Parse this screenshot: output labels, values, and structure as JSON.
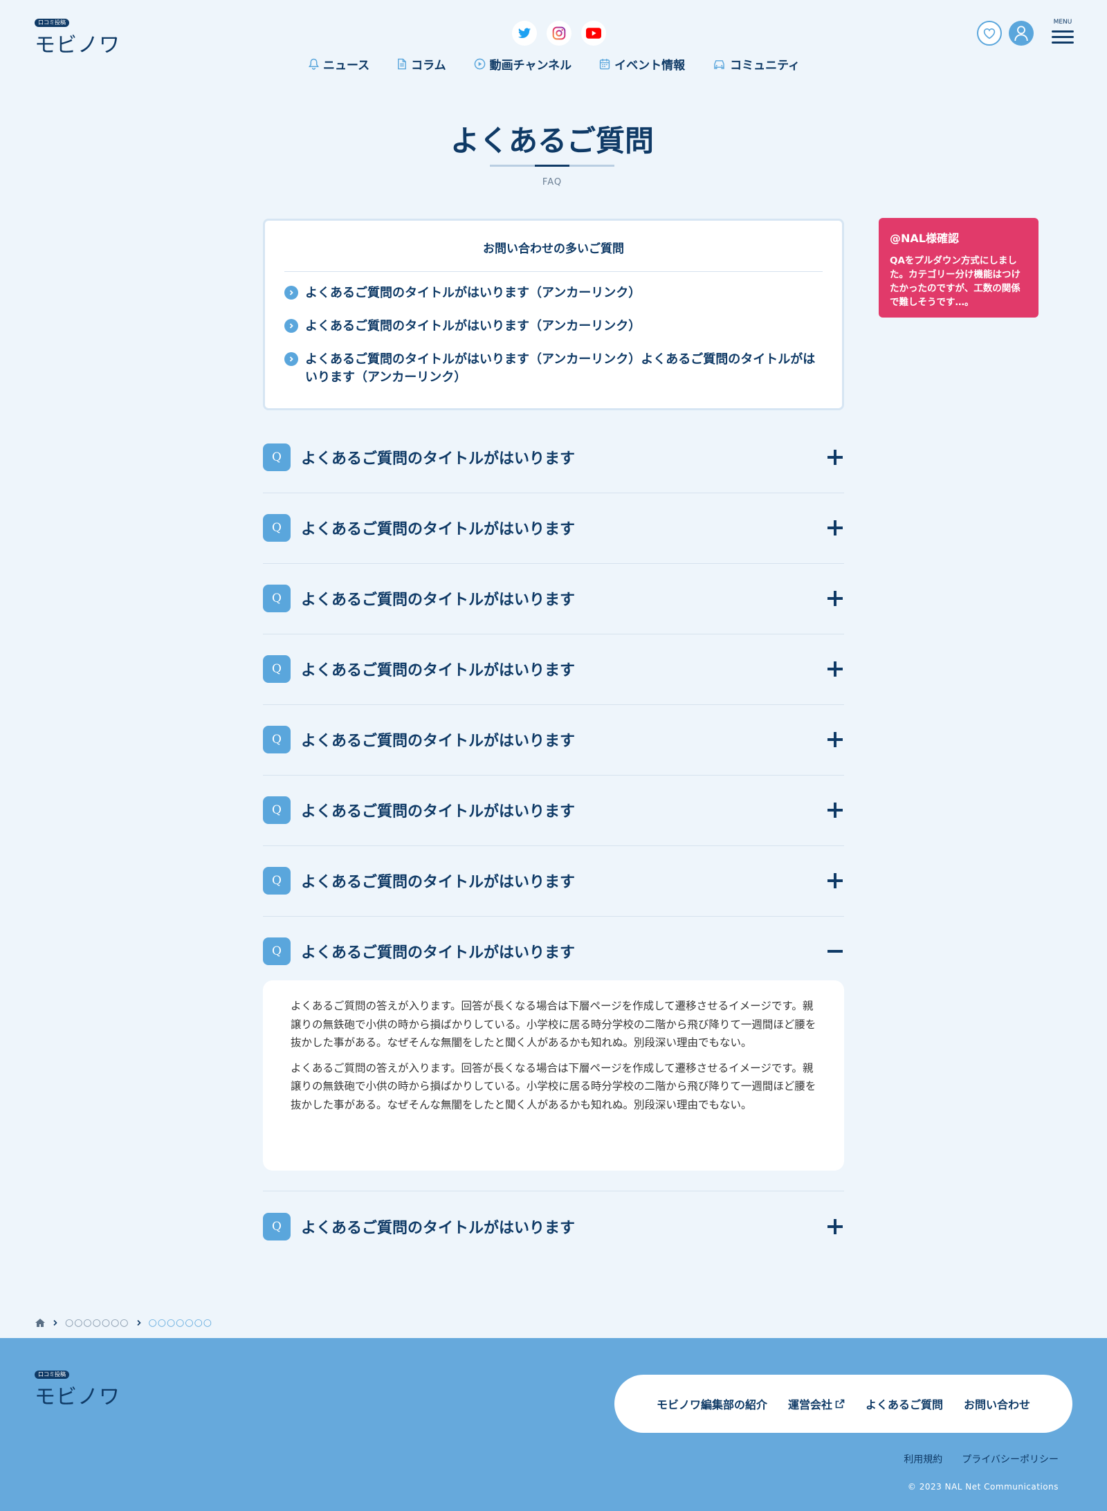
{
  "brand": {
    "badge": "口コミ投稿",
    "name": "モビノワ"
  },
  "header": {
    "social": [
      {
        "icon": "twitter-icon"
      },
      {
        "icon": "instagram-icon"
      },
      {
        "icon": "youtube-icon"
      }
    ],
    "menu_label": "MENU",
    "nav": [
      {
        "label": "ニュース",
        "icon": "bell-icon"
      },
      {
        "label": "コラム",
        "icon": "document-icon"
      },
      {
        "label": "動画チャンネル",
        "icon": "play-icon"
      },
      {
        "label": "イベント情報",
        "icon": "calendar-icon"
      },
      {
        "label": "コミュニティ",
        "icon": "car-icon"
      }
    ]
  },
  "page": {
    "title": "よくあるご質問",
    "subtitle": "FAQ"
  },
  "popular": {
    "title": "お問い合わせの多いご質問",
    "items": [
      "よくあるご質問のタイトルがはいります（アンカーリンク）",
      "よくあるご質問のタイトルがはいります（アンカーリンク）",
      "よくあるご質問のタイトルがはいります（アンカーリンク）よくあるご質問のタイトルがはいります（アンカーリンク）"
    ]
  },
  "note": {
    "title": "@NAL様確認",
    "body": "QAをプルダウン方式にしました。カテゴリー分け機能はつけたかったのですが、工数の関係で難しそうです…。"
  },
  "faq": {
    "q_label": "Q",
    "items": [
      {
        "question": "よくあるご質問のタイトルがはいります",
        "open": false
      },
      {
        "question": "よくあるご質問のタイトルがはいります",
        "open": false
      },
      {
        "question": "よくあるご質問のタイトルがはいります",
        "open": false
      },
      {
        "question": "よくあるご質問のタイトルがはいります",
        "open": false
      },
      {
        "question": "よくあるご質問のタイトルがはいります",
        "open": false
      },
      {
        "question": "よくあるご質問のタイトルがはいります",
        "open": false
      },
      {
        "question": "よくあるご質問のタイトルがはいります",
        "open": false
      },
      {
        "question": "よくあるご質問のタイトルがはいります",
        "open": true
      },
      {
        "question": "よくあるご質問のタイトルがはいります",
        "open": false
      }
    ],
    "answer": [
      "よくあるご質問の答えが入ります。回答が長くなる場合は下層ページを作成して遷移させるイメージです。親譲りの無鉄砲で小供の時から損ばかりしている。小学校に居る時分学校の二階から飛び降りて一週間ほど腰を抜かした事がある。なぜそんな無闇をしたと聞く人があるかも知れぬ。別段深い理由でもない。",
      "よくあるご質問の答えが入ります。回答が長くなる場合は下層ページを作成して遷移させるイメージです。親譲りの無鉄砲で小供の時から損ばかりしている。小学校に居る時分学校の二階から飛び降りて一週間ほど腰を抜かした事がある。なぜそんな無闇をしたと聞く人があるかも知れぬ。別段深い理由でもない。"
    ]
  },
  "breadcrumb": {
    "parent": "○○○○○○○",
    "current": "○○○○○○○"
  },
  "footer": {
    "nav": [
      "モビノワ編集部の紹介",
      "運営会社",
      "よくあるご質問",
      "お問い合わせ"
    ],
    "legal": [
      "利用規約",
      "プライバシーポリシー"
    ],
    "copyright": "© 2023 NAL Net Communications"
  },
  "colors": {
    "navy": "#0f3a66",
    "accent_blue": "#5aa6dc",
    "footer_bg": "#66a9dc",
    "note_pink": "#e13a6a",
    "page_bg": "#eef5fb"
  }
}
